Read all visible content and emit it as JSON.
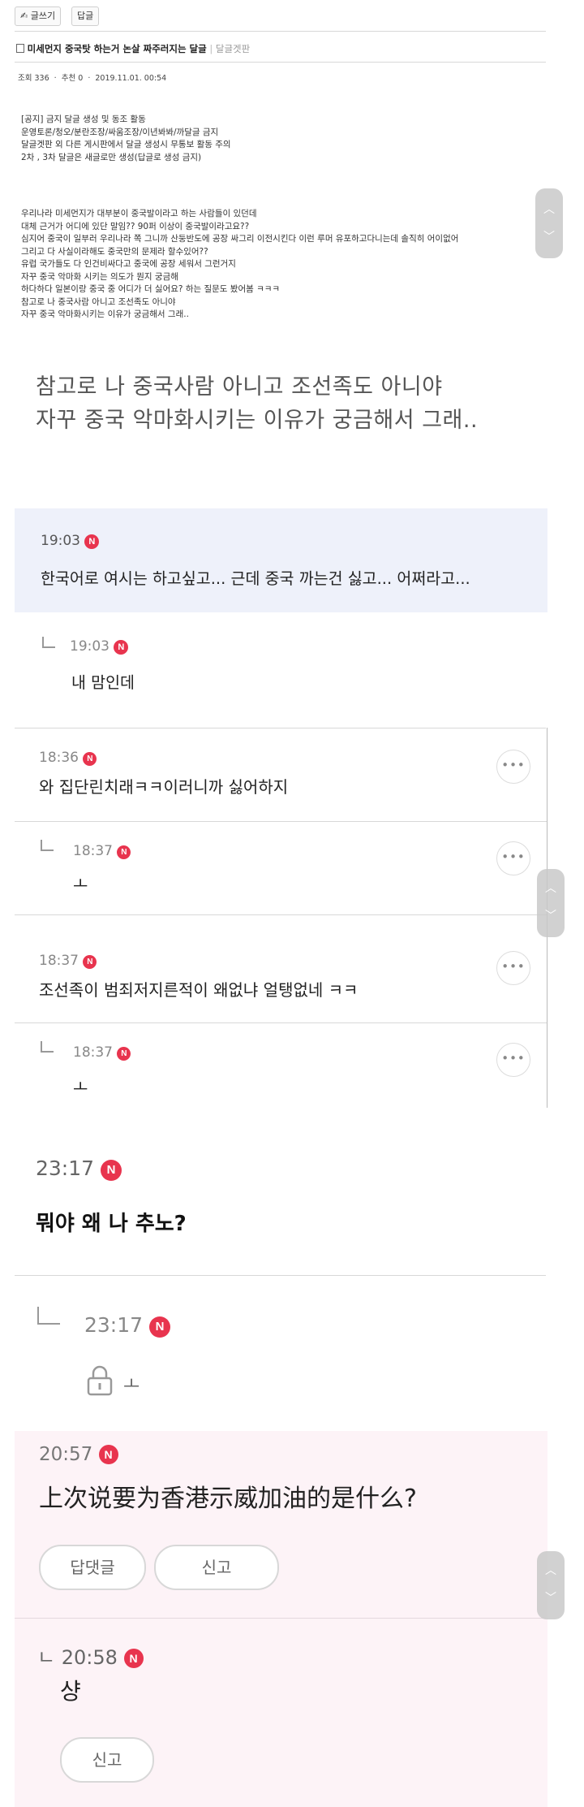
{
  "toolbar": {
    "write_label": "✍ 글쓰기",
    "reply_label": "답글"
  },
  "post": {
    "title": "미세먼지 중국탓 하는거 논살 짜주러지는 달글",
    "board": "달글겟판",
    "meta": "조회 336  ·  추천 0  ·  2019.11.01. 00:54",
    "notice_lines": [
      "[공지] 금지 달글 생성 및 동조 활동",
      "운영토론/청오/분란조장/싸움조장/이년봐봐/까달글 금지",
      "달글겟판 외 다른 게시판에서 달글 생성시 무통보 활동 주의",
      "2차 , 3차 달글은 새글로만 생성(답글로 생성 금지)"
    ],
    "body_lines": [
      "우리나라 미세먼지가 대부분이 중국발이라고 하는 사람들이 있던데",
      "대체 근거가 어디에 있단 말임?? 90퍼 이상이 중국발이라고요??",
      "심지어 중국이 일부러 우리나라 쪽 그니까 산둥반도에 공장 싸그리 이전시킨다 이런 루머 유포하고다니는데 솔직히 어이없어",
      "그리고 다 사실이라해도 중국만의 문제라 할수있어??",
      "유럽 국가들도 다 인건비싸다고 중국에 공장 세워서 그런거지",
      "자꾸 중국 악마화 시키는 의도가 뭔지 궁금해",
      "하다하다 일본이랑 중국 중 어디가 더 싫어요? 하는 질문도 봤어봄 ㅋㅋㅋ",
      "참고로 나 중국사람 아니고 조선족도 아니야",
      "자꾸 중국 악마화시키는 이유가 궁금해서 그래.."
    ],
    "zoom_lines": [
      "참고로 나 중국사람 아니고 조선족도 아니야",
      "자꾸 중국 악마화시키는 이유가 궁금해서 그래.."
    ]
  },
  "comments_a": [
    {
      "time": "19:03",
      "text": "한국어로 여시는 하고싶고... 근데 중국 까는건 싫고... 어쩌라고..."
    },
    {
      "time": "19:03",
      "text": "내 맘인데"
    }
  ],
  "comments_b": [
    {
      "time": "18:36",
      "text": "와 집단린치래ㅋㅋ이러니까 싫어하지"
    },
    {
      "time": "18:37",
      "text": "ㅗ"
    },
    {
      "time": "18:37",
      "text": "조선족이 범죄저지른적이 왜없냐 얼탱없네 ㅋㅋ"
    },
    {
      "time": "18:37",
      "text": "ㅗ"
    }
  ],
  "comments_c": [
    {
      "time": "23:17",
      "text": "뭐야 왜 나 추노?"
    },
    {
      "time": "23:17",
      "text": "ㅗ"
    }
  ],
  "comments_d": [
    {
      "time": "20:57",
      "text": "上次说要为香港示威加油的是什么?"
    },
    {
      "time": "20:58",
      "text": "샹"
    }
  ],
  "badge_letter": "N",
  "more_glyph": "•••",
  "reply_glyph": "ㄴ",
  "buttons": {
    "reply_comment": "답댓글",
    "report": "신고"
  },
  "scroll_glyphs": {
    "up": "︿",
    "down": "﹀"
  },
  "colors": {
    "badge_red": "#e8344e",
    "highlight_blue": "#eef1fa",
    "highlight_pink": "#fdf3f7"
  }
}
